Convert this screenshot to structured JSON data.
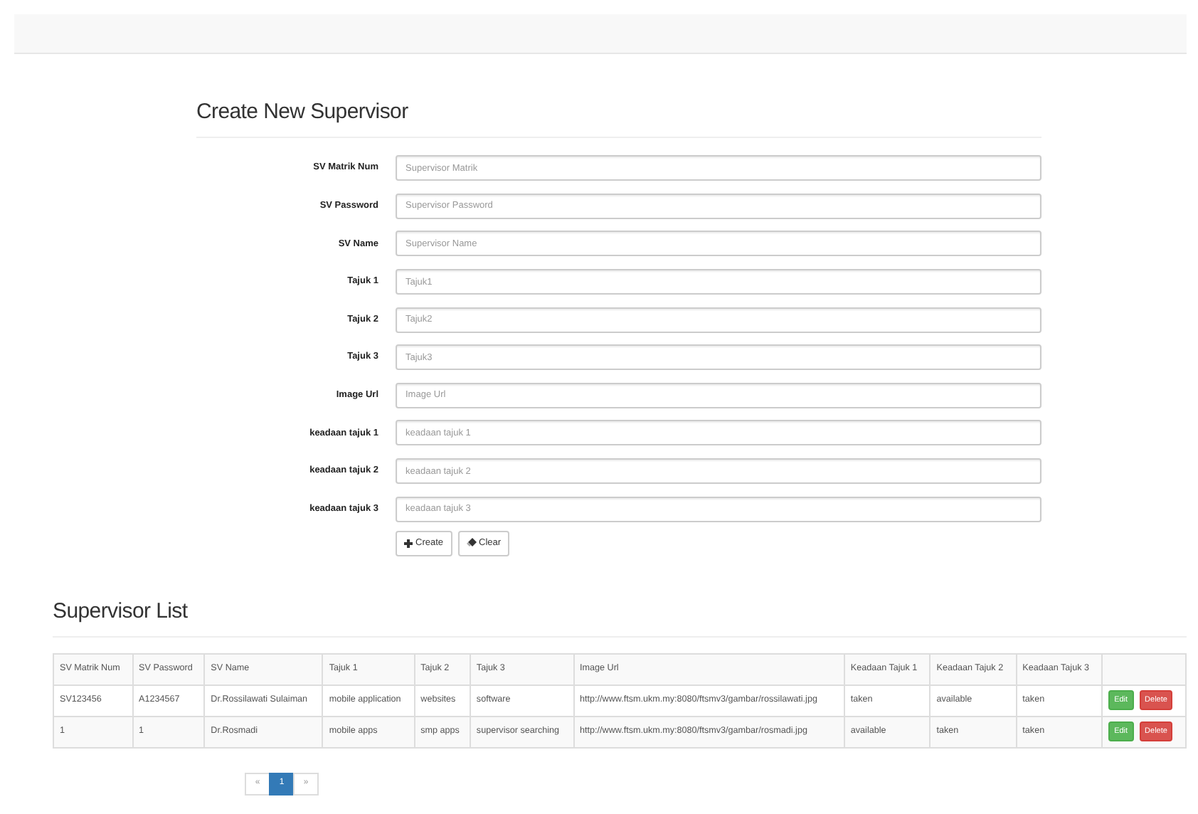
{
  "form": {
    "title": "Create New Supervisor",
    "fields": [
      {
        "label": "SV Matrik Num",
        "placeholder": "Supervisor Matrik"
      },
      {
        "label": "SV Password",
        "placeholder": "Supervisor Password"
      },
      {
        "label": "SV Name",
        "placeholder": "Supervisor Name"
      },
      {
        "label": "Tajuk 1",
        "placeholder": "Tajuk1"
      },
      {
        "label": "Tajuk 2",
        "placeholder": "Tajuk2"
      },
      {
        "label": "Tajuk 3",
        "placeholder": "Tajuk3"
      },
      {
        "label": "Image Url",
        "placeholder": "Image Url"
      },
      {
        "label": "keadaan tajuk 1",
        "placeholder": "keadaan tajuk 1"
      },
      {
        "label": "keadaan tajuk 2",
        "placeholder": "keadaan tajuk 2"
      },
      {
        "label": "keadaan tajuk 3",
        "placeholder": "keadaan tajuk 3"
      }
    ],
    "buttons": [
      {
        "label": "Create",
        "kind": "create"
      },
      {
        "label": "Clear",
        "kind": "clear"
      }
    ]
  },
  "list": {
    "title": "Supervisor List",
    "table": {
      "columns": [
        "SV Matrik Num",
        "SV Password",
        "SV Name",
        "Tajuk 1",
        "Tajuk 2",
        "Tajuk 3",
        "Image Url",
        "Keadaan Tajuk 1",
        "Keadaan Tajuk 2",
        "Keadaan Tajuk 3"
      ],
      "rows": [
        {
          "cells": [
            "SV123456",
            "A1234567",
            "Dr.Rossilawati Sulaiman",
            "mobile application",
            "websites",
            "software",
            "http://www.ftsm.ukm.my:8080/ftsmv3/gambar/rossilawati.jpg",
            "taken",
            "available",
            "taken"
          ],
          "actions": [
            {
              "label": "Edit",
              "kind": "edit"
            },
            {
              "label": "Delete",
              "kind": "delete"
            }
          ]
        },
        {
          "cells": [
            "1",
            "1",
            "Dr.Rosmadi",
            "mobile apps",
            "smp apps",
            "supervisor searching",
            "http://www.ftsm.ukm.my:8080/ftsmv3/gambar/rosmadi.jpg",
            "available",
            "taken",
            "taken"
          ],
          "actions": [
            {
              "label": "Edit",
              "kind": "edit"
            },
            {
              "label": "Delete",
              "kind": "delete"
            }
          ]
        }
      ]
    },
    "pagination": [
      {
        "label": "«",
        "selected": false
      },
      {
        "label": "1",
        "selected": true
      },
      {
        "label": "»",
        "selected": false
      }
    ]
  }
}
